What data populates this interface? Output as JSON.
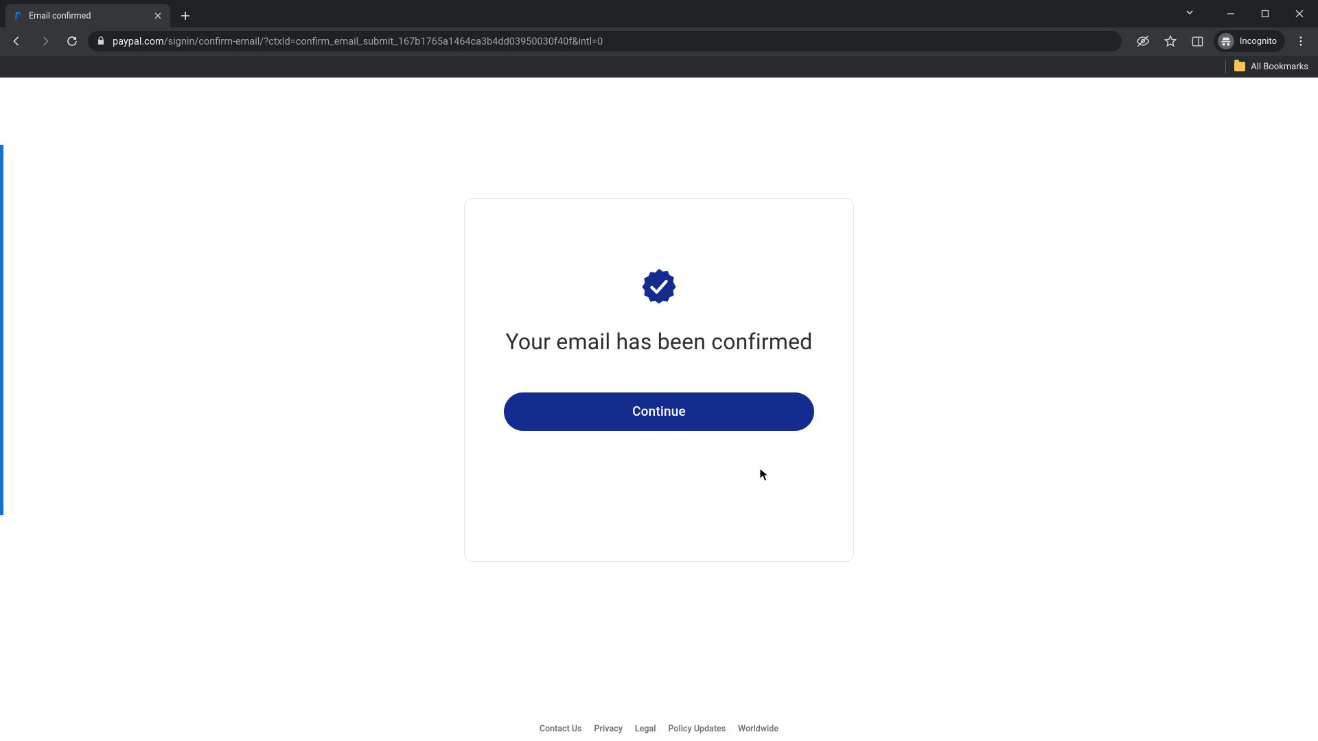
{
  "browser": {
    "tab_title": "Email confirmed",
    "url_host": "paypal.com",
    "url_path": "/signin/confirm-email/?ctxId=confirm_email_submit_167b1765a1464ca3b4dd03950030f40f&intl=0",
    "incognito_label": "Incognito",
    "all_bookmarks_label": "All Bookmarks"
  },
  "page": {
    "headline": "Your email has been confirmed",
    "continue_label": "Continue"
  },
  "footer": {
    "links": [
      "Contact Us",
      "Privacy",
      "Legal",
      "Policy Updates",
      "Worldwide"
    ]
  }
}
